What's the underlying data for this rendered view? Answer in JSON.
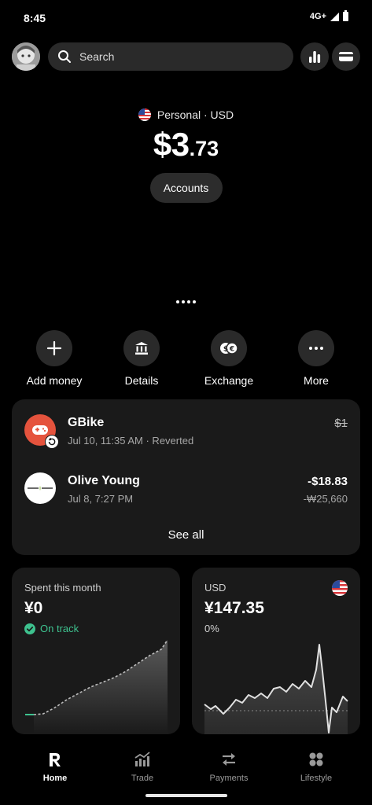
{
  "status_bar": {
    "time": "8:45",
    "network": "4G+"
  },
  "header": {
    "search_placeholder": "Search",
    "stats_icon": "bar-chart-icon",
    "cards_icon": "credit-card-icon"
  },
  "balance": {
    "account_label": "Personal · USD",
    "whole": "$3",
    "fraction": ".73",
    "accounts_button": "Accounts"
  },
  "actions": [
    {
      "label": "Add money",
      "icon": "plus-icon"
    },
    {
      "label": "Details",
      "icon": "bank-icon"
    },
    {
      "label": "Exchange",
      "icon": "exchange-icon"
    },
    {
      "label": "More",
      "icon": "more-icon"
    }
  ],
  "transactions": [
    {
      "name": "GBike",
      "meta": "Jul 10, 11:35 AM · Reverted",
      "amount": "$1",
      "amount_secondary": "",
      "logo_color": "#e5533d"
    },
    {
      "name": "Olive Young",
      "meta": "Jul 8, 7:27 PM",
      "amount": "-$18.83",
      "amount_secondary": "-₩25,660",
      "logo_color": "#ffffff"
    }
  ],
  "see_all": "See all",
  "spent_card": {
    "title": "Spent this month",
    "value": "¥0",
    "status": "On track",
    "status_color": "#3ec28f"
  },
  "currency_card": {
    "title": "USD",
    "value": "¥147.35",
    "change": "0%"
  },
  "bottom_nav": [
    {
      "label": "Home",
      "icon": "revolut-logo-icon",
      "active": true
    },
    {
      "label": "Trade",
      "icon": "trade-chart-icon",
      "active": false
    },
    {
      "label": "Payments",
      "icon": "transfer-arrows-icon",
      "active": false
    },
    {
      "label": "Lifestyle",
      "icon": "lifestyle-grid-icon",
      "active": false
    }
  ]
}
